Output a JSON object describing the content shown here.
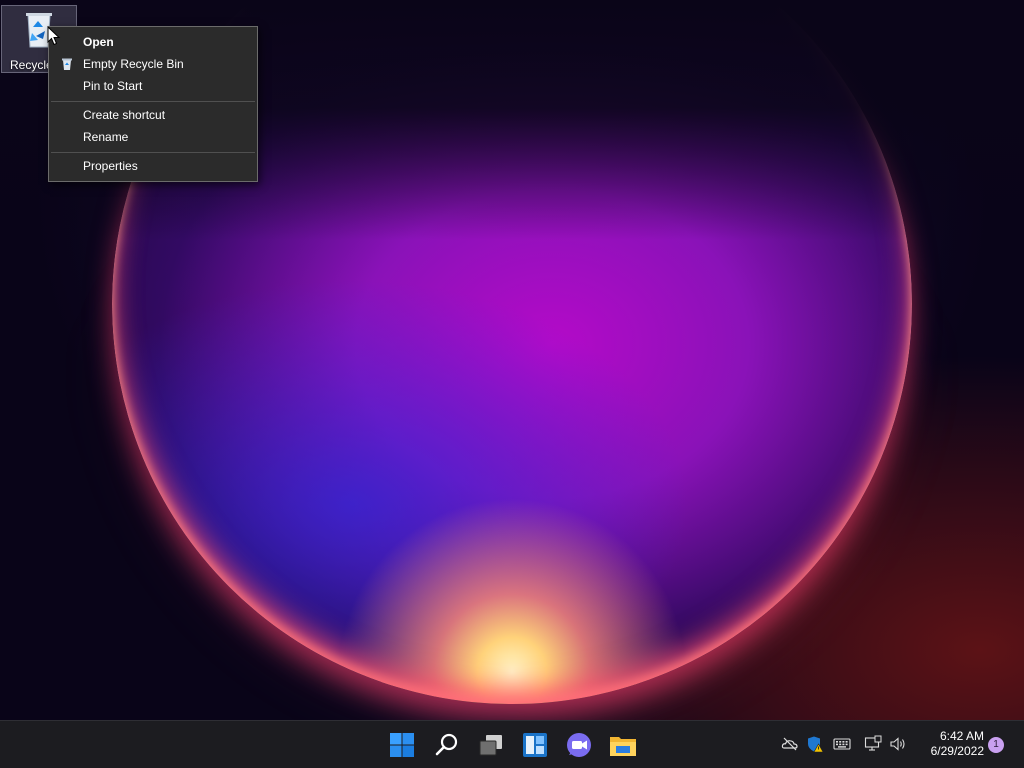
{
  "desktop": {
    "icons": [
      {
        "label": "Recycle Bin",
        "icon": "recycle-bin-icon"
      }
    ]
  },
  "context_menu": {
    "items": [
      {
        "label": "Open",
        "bold": true
      },
      {
        "label": "Empty Recycle Bin",
        "icon": "recycle-bin-icon"
      },
      {
        "label": "Pin to Start"
      },
      {
        "label": "Create shortcut"
      },
      {
        "label": "Rename"
      },
      {
        "label": "Properties"
      }
    ]
  },
  "taskbar": {
    "pinned": [
      {
        "name": "Start",
        "icon": "windows-start-icon"
      },
      {
        "name": "Search",
        "icon": "search-icon"
      },
      {
        "name": "Task View",
        "icon": "task-view-icon"
      },
      {
        "name": "Widgets",
        "icon": "widgets-icon"
      },
      {
        "name": "Chat",
        "icon": "chat-icon"
      },
      {
        "name": "File Explorer",
        "icon": "file-explorer-icon"
      }
    ],
    "tray": {
      "icons": [
        "onedrive-offline-icon",
        "defender-warning-icon",
        "keyboard-icon",
        "network-icon",
        "volume-icon"
      ],
      "time": "6:42 AM",
      "date": "6/29/2022",
      "notification_count": "1"
    }
  },
  "colors": {
    "accent": "#0078d4",
    "menu_bg": "#2b2b2b",
    "taskbar_bg": "#1c1c20"
  }
}
